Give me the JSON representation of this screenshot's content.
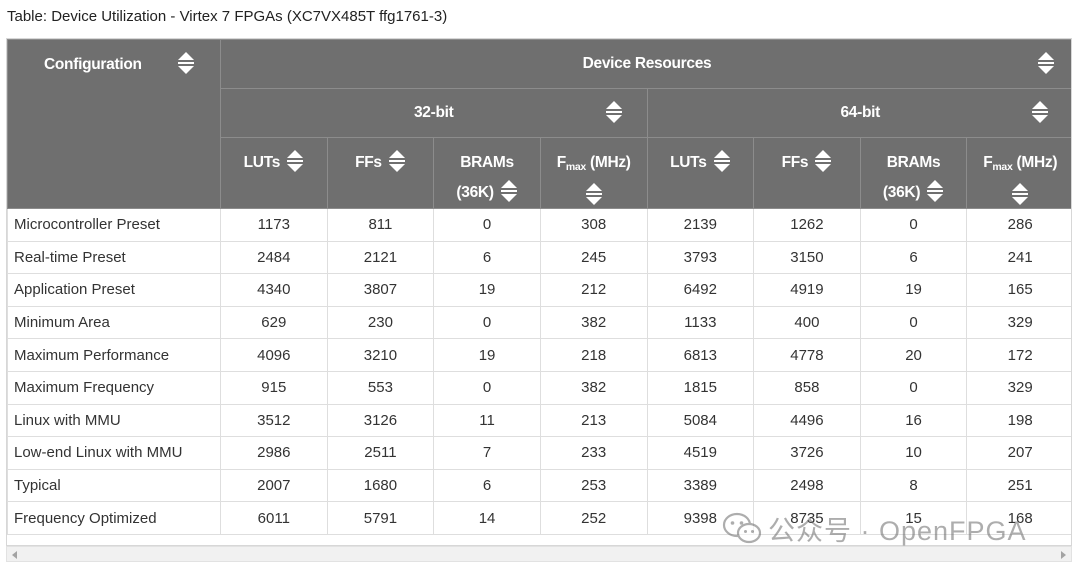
{
  "caption": "Table: Device Utilization - Virtex 7 FPGAs (XC7VX485T ffg1761-3)",
  "header": {
    "configuration": "Configuration",
    "device_resources": "Device Resources",
    "groups": [
      "32-bit",
      "64-bit"
    ],
    "columns": [
      {
        "main": "LUTs",
        "sub": ""
      },
      {
        "main": "FFs",
        "sub": ""
      },
      {
        "main": "BRAMs",
        "second": "(36K)"
      },
      {
        "main": "F",
        "sub": "max",
        "tail": " (MHz)"
      },
      {
        "main": "LUTs",
        "sub": ""
      },
      {
        "main": "FFs",
        "sub": ""
      },
      {
        "main": "BRAMs",
        "second": "(36K)"
      },
      {
        "main": "F",
        "sub": "max",
        "tail": " (MHz)"
      }
    ]
  },
  "rows": [
    {
      "name": "Microcontroller Preset",
      "values": [
        "1173",
        "811",
        "0",
        "308",
        "2139",
        "1262",
        "0",
        "286"
      ]
    },
    {
      "name": "Real-time Preset",
      "values": [
        "2484",
        "2121",
        "6",
        "245",
        "3793",
        "3150",
        "6",
        "241"
      ]
    },
    {
      "name": "Application Preset",
      "values": [
        "4340",
        "3807",
        "19",
        "212",
        "6492",
        "4919",
        "19",
        "165"
      ]
    },
    {
      "name": "Minimum Area",
      "values": [
        "629",
        "230",
        "0",
        "382",
        "1133",
        "400",
        "0",
        "329"
      ]
    },
    {
      "name": "Maximum Performance",
      "values": [
        "4096",
        "3210",
        "19",
        "218",
        "6813",
        "4778",
        "20",
        "172"
      ]
    },
    {
      "name": "Maximum Frequency",
      "values": [
        "915",
        "553",
        "0",
        "382",
        "1815",
        "858",
        "0",
        "329"
      ]
    },
    {
      "name": "Linux with MMU",
      "values": [
        "3512",
        "3126",
        "11",
        "213",
        "5084",
        "4496",
        "16",
        "198"
      ]
    },
    {
      "name": "Low-end Linux with MMU",
      "values": [
        "2986",
        "2511",
        "7",
        "233",
        "4519",
        "3726",
        "10",
        "207"
      ]
    },
    {
      "name": "Typical",
      "values": [
        "2007",
        "1680",
        "6",
        "253",
        "3389",
        "2498",
        "8",
        "251"
      ]
    },
    {
      "name": "Frequency Optimized",
      "values": [
        "6011",
        "5791",
        "14",
        "252",
        "9398",
        "8735",
        "15",
        "168"
      ]
    }
  ],
  "watermark": "公众号 · OpenFPGA",
  "icons": {
    "sort": "sort-arrows-icon",
    "wechat": "wechat-logo-icon"
  }
}
